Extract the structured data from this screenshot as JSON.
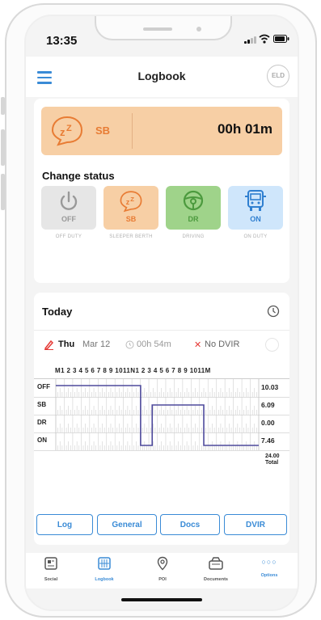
{
  "status_bar": {
    "time": "13:35"
  },
  "header": {
    "title": "Logbook",
    "eld_label": "ELD"
  },
  "current_status": {
    "code": "SB",
    "duration": "00h 01m",
    "color": "#e87c34",
    "bg": "#f7cfa5"
  },
  "change_status": {
    "title": "Change status",
    "options": [
      {
        "code": "OFF",
        "label": "OFF DUTY",
        "color": "#999999",
        "bg": "#e6e6e6",
        "icon": "power-icon"
      },
      {
        "code": "SB",
        "label": "SLEEPER BERTH",
        "color": "#e87c34",
        "bg": "#f7cfa5",
        "icon": "sleep-icon"
      },
      {
        "code": "DR",
        "label": "DRIVING",
        "color": "#4c9a3e",
        "bg": "#9fd38a",
        "icon": "steering-wheel-icon"
      },
      {
        "code": "ON",
        "label": "ON DUTY",
        "color": "#2f7fd0",
        "bg": "#cfe6fb",
        "icon": "truck-icon"
      }
    ]
  },
  "today": {
    "title": "Today",
    "day": "Thu",
    "date": "Mar 12",
    "drive_time": "00h 54m",
    "dvir_status": "No DVIR",
    "hours_axis": "M1 2 3 4 5 6 7 8 9 1011N1 2 3 4 5 6 7 8 9 1011M",
    "rows": [
      {
        "label": "OFF",
        "total": "10.03"
      },
      {
        "label": "SB",
        "total": "6.09"
      },
      {
        "label": "DR",
        "total": "0.00"
      },
      {
        "label": "ON",
        "total": "7.46"
      }
    ],
    "total_value": "24.00",
    "total_label": "Total"
  },
  "actions": {
    "log": "Log",
    "general": "General",
    "docs": "Docs",
    "dvir": "DVIR"
  },
  "tabbar": [
    {
      "label": "Social",
      "icon": "social-icon"
    },
    {
      "label": "Logbook",
      "icon": "logbook-icon",
      "active": true
    },
    {
      "label": "POI",
      "icon": "poi-icon"
    },
    {
      "label": "Documents",
      "icon": "documents-icon"
    },
    {
      "label": "Options",
      "icon": "more-icon",
      "active": true
    }
  ],
  "colors": {
    "accent": "#3a8bd6",
    "graph_line": "#4e4a9c",
    "dvir_x": "#e53935"
  }
}
